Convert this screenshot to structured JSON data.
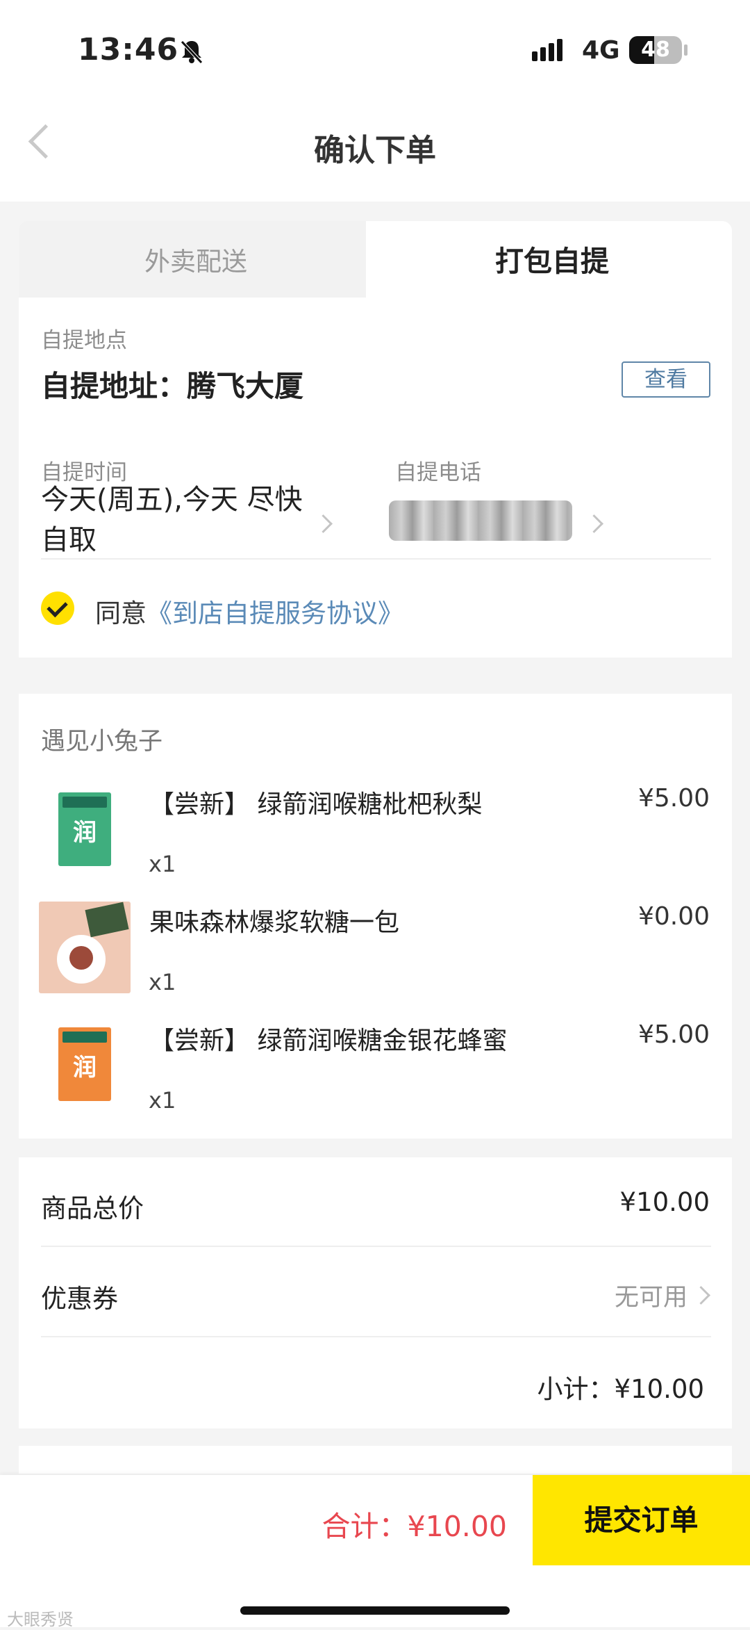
{
  "status_bar": {
    "time": "13:46",
    "network": "4G",
    "battery": "48",
    "battery_level": 0.48
  },
  "header": {
    "title": "确认下单"
  },
  "tabs": [
    {
      "label": "外卖配送",
      "active": false
    },
    {
      "label": "打包自提",
      "active": true
    }
  ],
  "pickup": {
    "location_label": "自提地点",
    "address": "自提地址：腾飞大厦",
    "view_button": "查看",
    "time_label": "自提时间",
    "time_value": "今天(周五),今天 尽快自取",
    "phone_label": "自提电话",
    "agree_text": "同意",
    "agreement_link": "《到店自提服务协议》"
  },
  "shop": {
    "name": "遇见小兔子",
    "items": [
      {
        "name": "【尝新】 绿箭润喉糖枇杷秋梨",
        "price": "¥5.00",
        "qty": "x1",
        "thumb_color": "#3fae7e",
        "thumb_text": "润"
      },
      {
        "name": "果味森林爆浆软糖一包",
        "price": "¥0.00",
        "qty": "x1",
        "thumb_color": "#f0c9b5",
        "thumb_text": ""
      },
      {
        "name": "【尝新】 绿箭润喉糖金银花蜂蜜",
        "price": "¥5.00",
        "qty": "x1",
        "thumb_color": "#f0883a",
        "thumb_text": "润"
      }
    ]
  },
  "summary": {
    "goods_total_label": "商品总价",
    "goods_total": "¥10.00",
    "coupon_label": "优惠券",
    "coupon_value": "无可用",
    "subtotal": "小计：¥10.00"
  },
  "footer": {
    "total": "合计：¥10.00",
    "submit_label": "提交订单",
    "watermark": "大眼秀贤"
  },
  "colors": {
    "accent": "#ffe600",
    "price_red": "#e8474f",
    "link_blue": "#5a8ab7"
  }
}
